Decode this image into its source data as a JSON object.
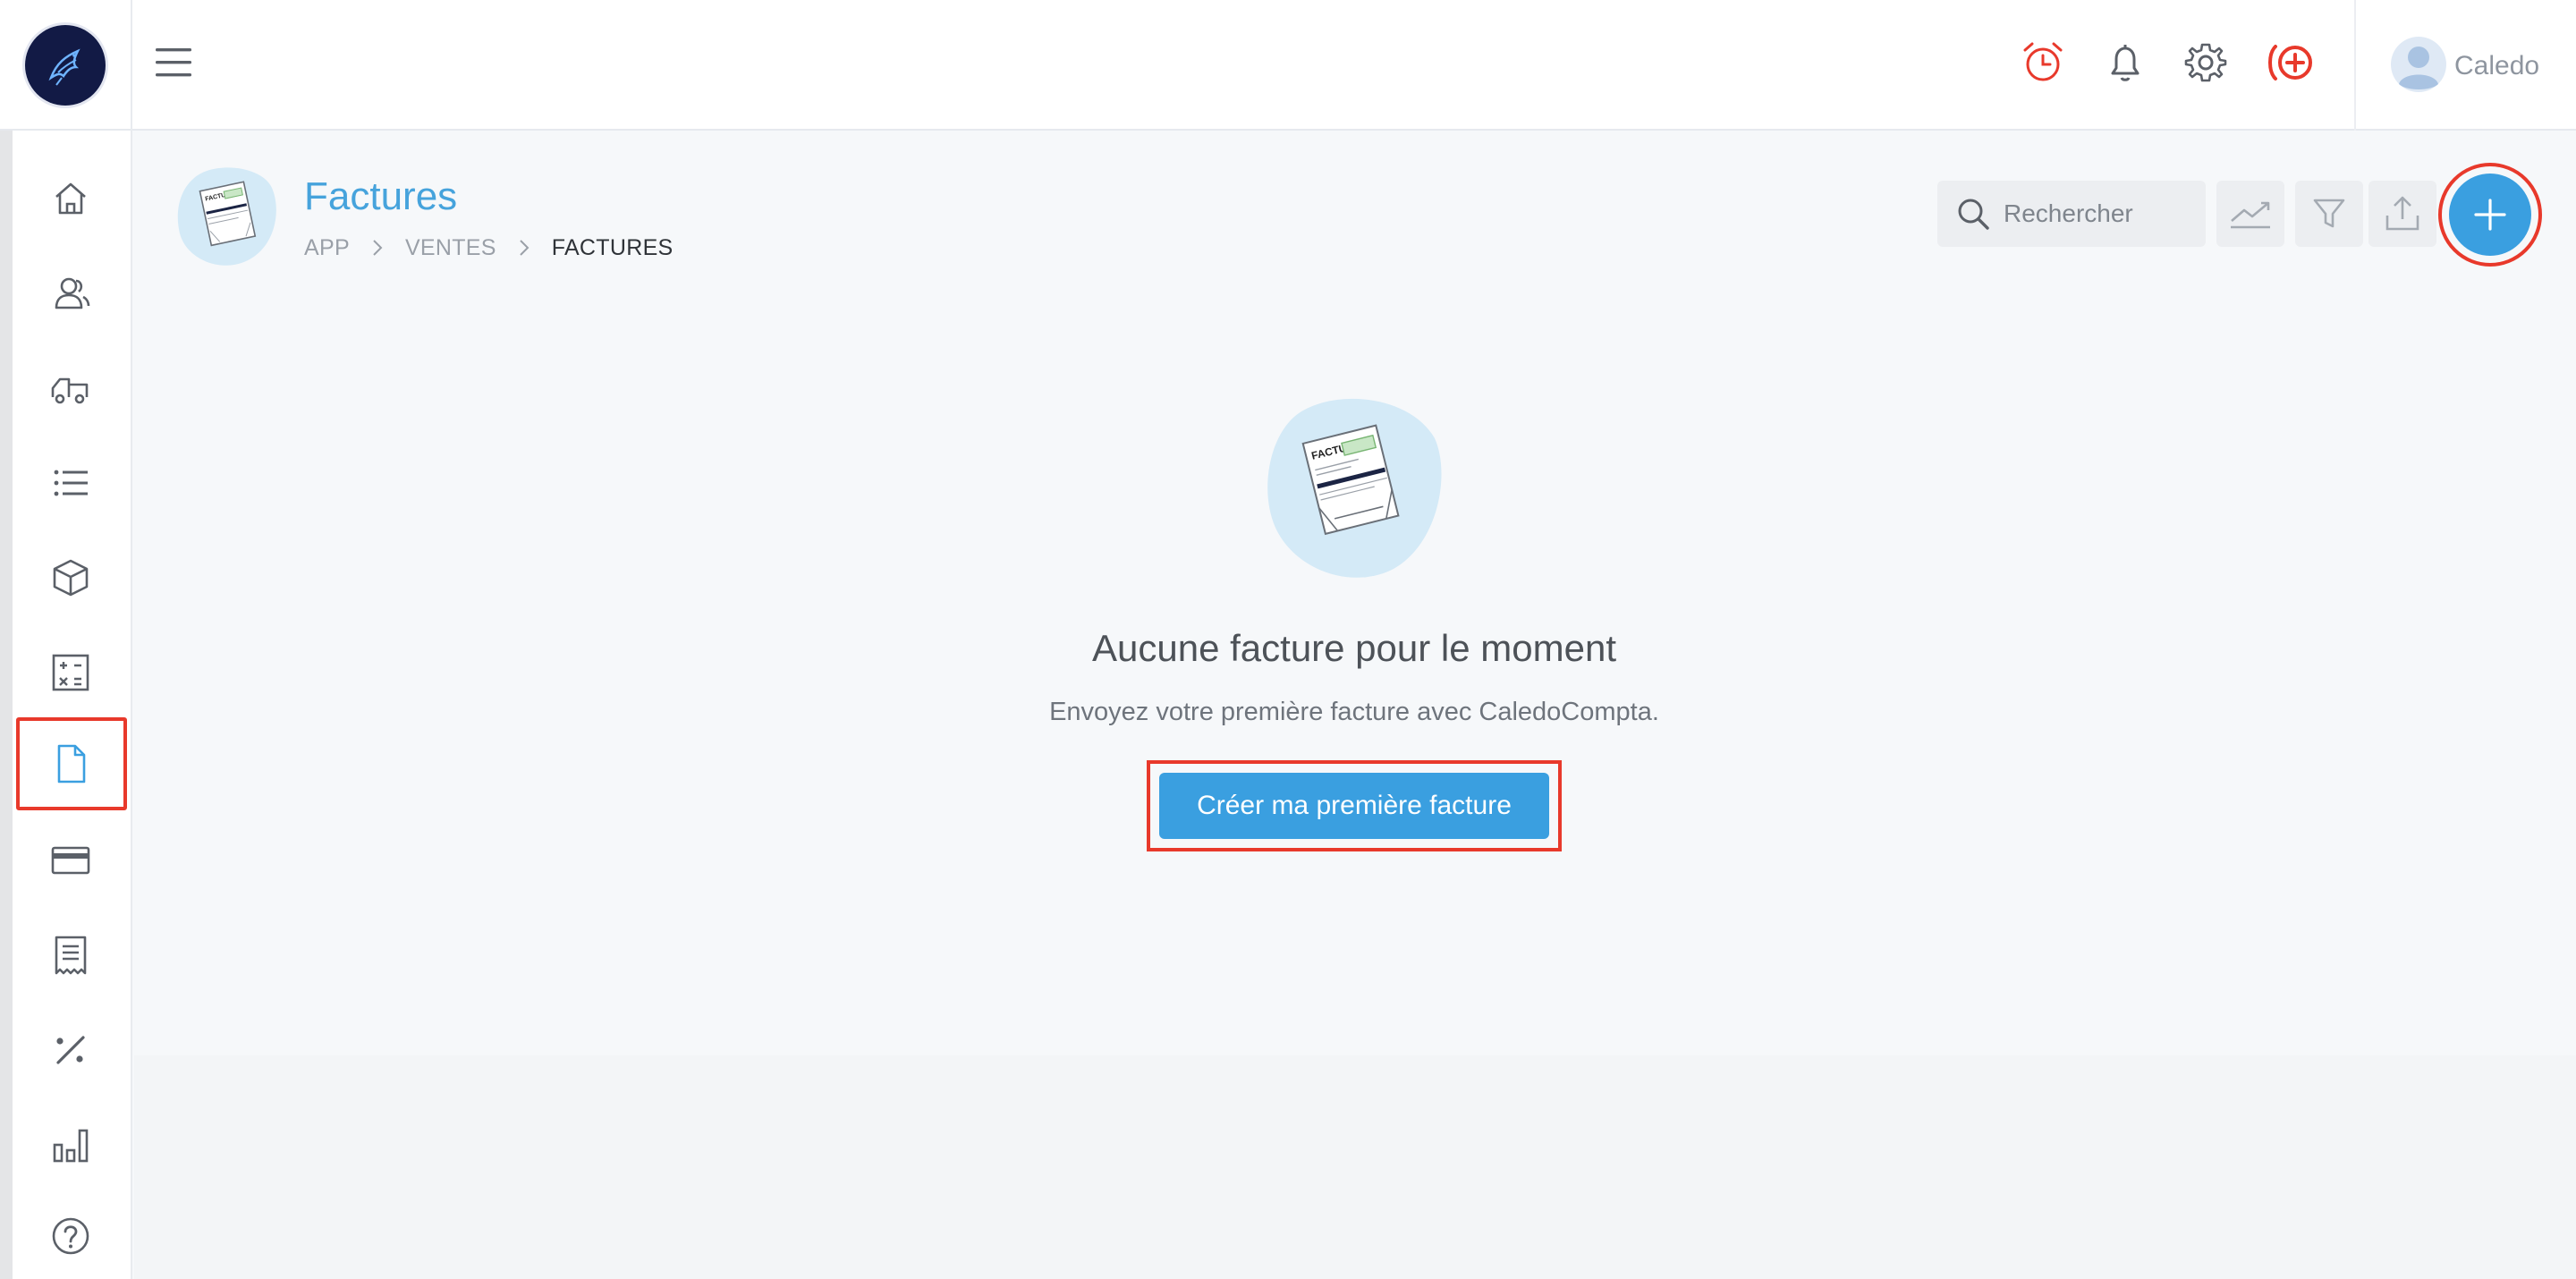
{
  "app": {
    "logo_icon": "bird-logo-icon",
    "user_name": "Caledo"
  },
  "header": {
    "icons": [
      "hamburger-menu-icon",
      "alarm-clock-icon",
      "bell-icon",
      "gear-icon",
      "add-circle-icon"
    ],
    "accent_color": "#e8392b"
  },
  "sidebar": {
    "items": [
      {
        "name": "home",
        "icon": "home-icon"
      },
      {
        "name": "contacts",
        "icon": "users-icon"
      },
      {
        "name": "purchases",
        "icon": "truck-icon"
      },
      {
        "name": "lists",
        "icon": "list-icon"
      },
      {
        "name": "products",
        "icon": "box-icon"
      },
      {
        "name": "accounting",
        "icon": "calculator-icon"
      },
      {
        "name": "invoices",
        "icon": "document-icon",
        "active": true
      },
      {
        "name": "payments",
        "icon": "credit-card-icon"
      },
      {
        "name": "receipts",
        "icon": "receipt-icon"
      },
      {
        "name": "taxes",
        "icon": "percent-icon"
      },
      {
        "name": "reports",
        "icon": "bar-chart-icon"
      },
      {
        "name": "help",
        "icon": "help-icon"
      }
    ]
  },
  "page": {
    "title": "Factures",
    "breadcrumb": [
      "APP",
      "VENTES",
      "FACTURES"
    ],
    "search_placeholder": "Rechercher",
    "illustration_text": "FACTURE",
    "toolbar_icons": [
      "trend-chart-icon",
      "filter-icon",
      "upload-icon",
      "plus-icon"
    ]
  },
  "empty_state": {
    "title": "Aucune facture pour le moment",
    "subtitle": "Envoyez votre première facture avec CaledoCompta.",
    "button_label": "Créer ma première facture"
  },
  "colors": {
    "primary": "#3a9fe0",
    "title_blue": "#46a3dc",
    "highlight_red": "#e8392b",
    "background": "#f6f8fa"
  }
}
